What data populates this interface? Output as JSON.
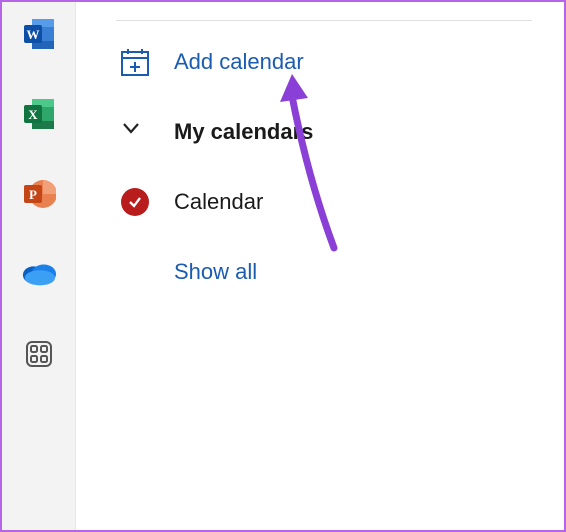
{
  "rail": {
    "items": [
      {
        "name": "word-icon"
      },
      {
        "name": "excel-icon"
      },
      {
        "name": "powerpoint-icon"
      },
      {
        "name": "onedrive-icon"
      },
      {
        "name": "apps-icon"
      }
    ]
  },
  "panel": {
    "add_calendar_label": "Add calendar",
    "my_calendars_label": "My calendars",
    "calendar_item_label": "Calendar",
    "show_all_label": "Show all"
  },
  "colors": {
    "link": "#1b5cb3",
    "calendar_check": "#b81c1c",
    "accent_border": "#b565e8"
  }
}
